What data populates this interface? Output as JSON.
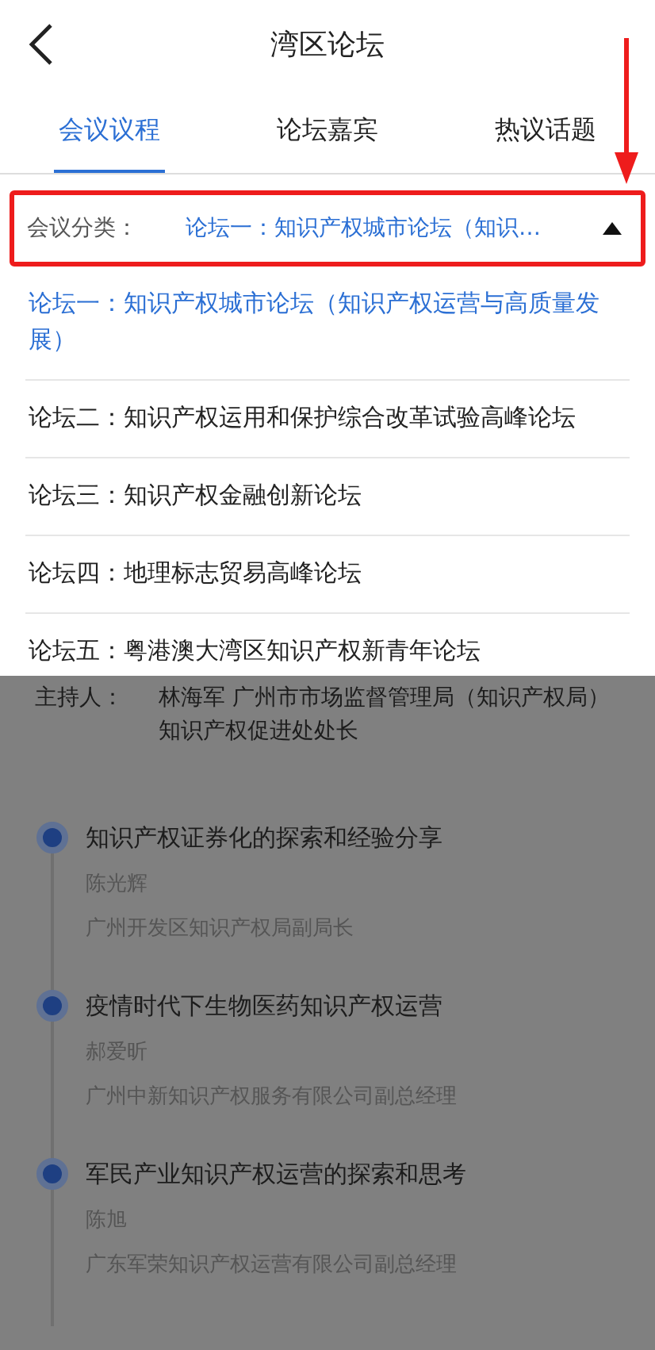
{
  "header": {
    "title": "湾区论坛"
  },
  "tabs": [
    {
      "label": "会议议程",
      "selected": true
    },
    {
      "label": "论坛嘉宾",
      "selected": false
    },
    {
      "label": "热议话题",
      "selected": false
    }
  ],
  "filter": {
    "label": "会议分类：",
    "value": "论坛一：知识产权城市论坛（知识…",
    "expanded": true
  },
  "options": [
    {
      "label": "论坛一：知识产权城市论坛（知识产权运营与高质量发展）",
      "selected": true
    },
    {
      "label": "论坛二：知识产权运用和保护综合改革试验高峰论坛",
      "selected": false
    },
    {
      "label": "论坛三：知识产权金融创新论坛",
      "selected": false
    },
    {
      "label": "论坛四：地理标志贸易高峰论坛",
      "selected": false
    },
    {
      "label": "论坛五：粤港澳大湾区知识产权新青年论坛",
      "selected": false
    }
  ],
  "host": {
    "label": "主持人：",
    "value": "林海军  广州市市场监督管理局（知识产权局）知识产权促进处处长"
  },
  "agenda": [
    {
      "title": "知识产权证券化的探索和经验分享",
      "speaker": "陈光辉",
      "position": "广州开发区知识产权局副局长"
    },
    {
      "title": "疫情时代下生物医药知识产权运营",
      "speaker": "郝爱昕",
      "position": "广州中新知识产权服务有限公司副总经理"
    },
    {
      "title": "军民产业知识产权运营的探索和思考",
      "speaker": "陈旭",
      "position": "广东军荣知识产权运营有限公司副总经理"
    }
  ]
}
